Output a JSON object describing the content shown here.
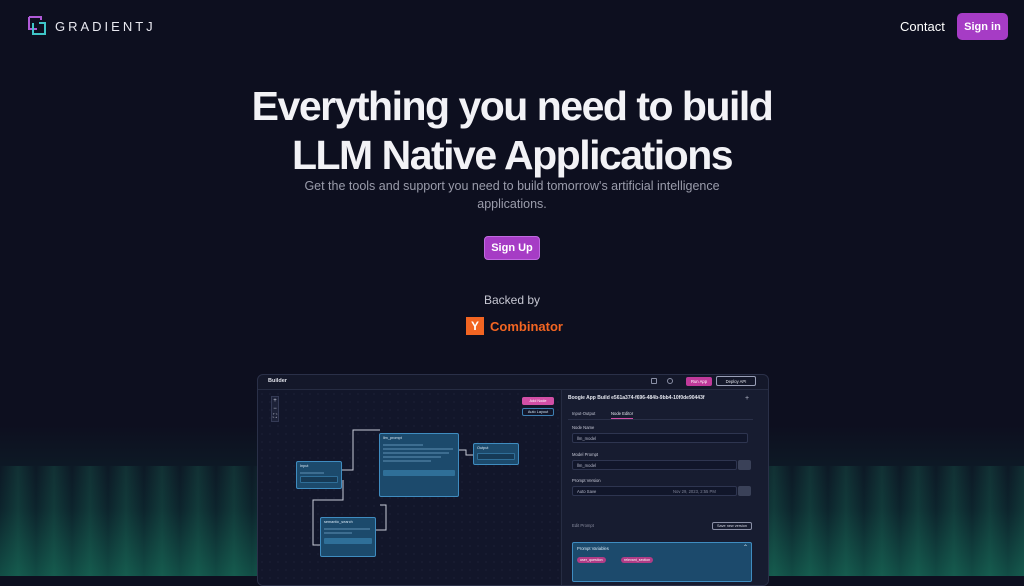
{
  "nav": {
    "logo_text": "GRADIENTJ",
    "contact": "Contact",
    "signin": "Sign in"
  },
  "hero": {
    "title_line1": "Everything you need to build",
    "title_line2": "LLM Native Applications",
    "subtitle": "Get the tools and support you need to build tomorrow's artificial intelligence applications.",
    "signup": "Sign Up"
  },
  "backed": {
    "label": "Backed by",
    "yc_letter": "Y",
    "yc_name": "Combinator"
  },
  "app": {
    "tab_label": "Builder",
    "run_app": "Run App",
    "deploy_api": "Deploy API",
    "add_node": "Add Node",
    "auto_layout": "Auto Layout",
    "zoom_in": "+",
    "zoom_out": "−",
    "zoom_fit": "⛶",
    "nodes": {
      "llm_prompt": "llm_prompt",
      "input": "Input",
      "output": "Output",
      "semantic_search": "semantic_search"
    },
    "panel": {
      "title": "Boogie App Build e561a374-f696-484b-9bb4-10f0de90443f",
      "plus": "+",
      "tab_io": "Input-Output",
      "tab_editor": "Node Editor",
      "node_name_label": "Node Name",
      "node_name_value": "llm_model",
      "model_prompt_label": "Model Prompt",
      "model_prompt_value": "llm_model",
      "prompt_version_label": "Prompt Version",
      "prompt_version_value": "Auto Save",
      "prompt_version_date": "Nov 29, 2023, 2:55 PM",
      "edit_prompt_label": "Edit Prompt",
      "save_new_version": "Save new version",
      "prompt_variables": "Prompt Variables",
      "chips": [
        "user_question",
        "relevant_section"
      ]
    }
  },
  "colors": {
    "background": "#0d0f1f",
    "accent": "#a63cc5",
    "yc_orange": "#f26522"
  }
}
